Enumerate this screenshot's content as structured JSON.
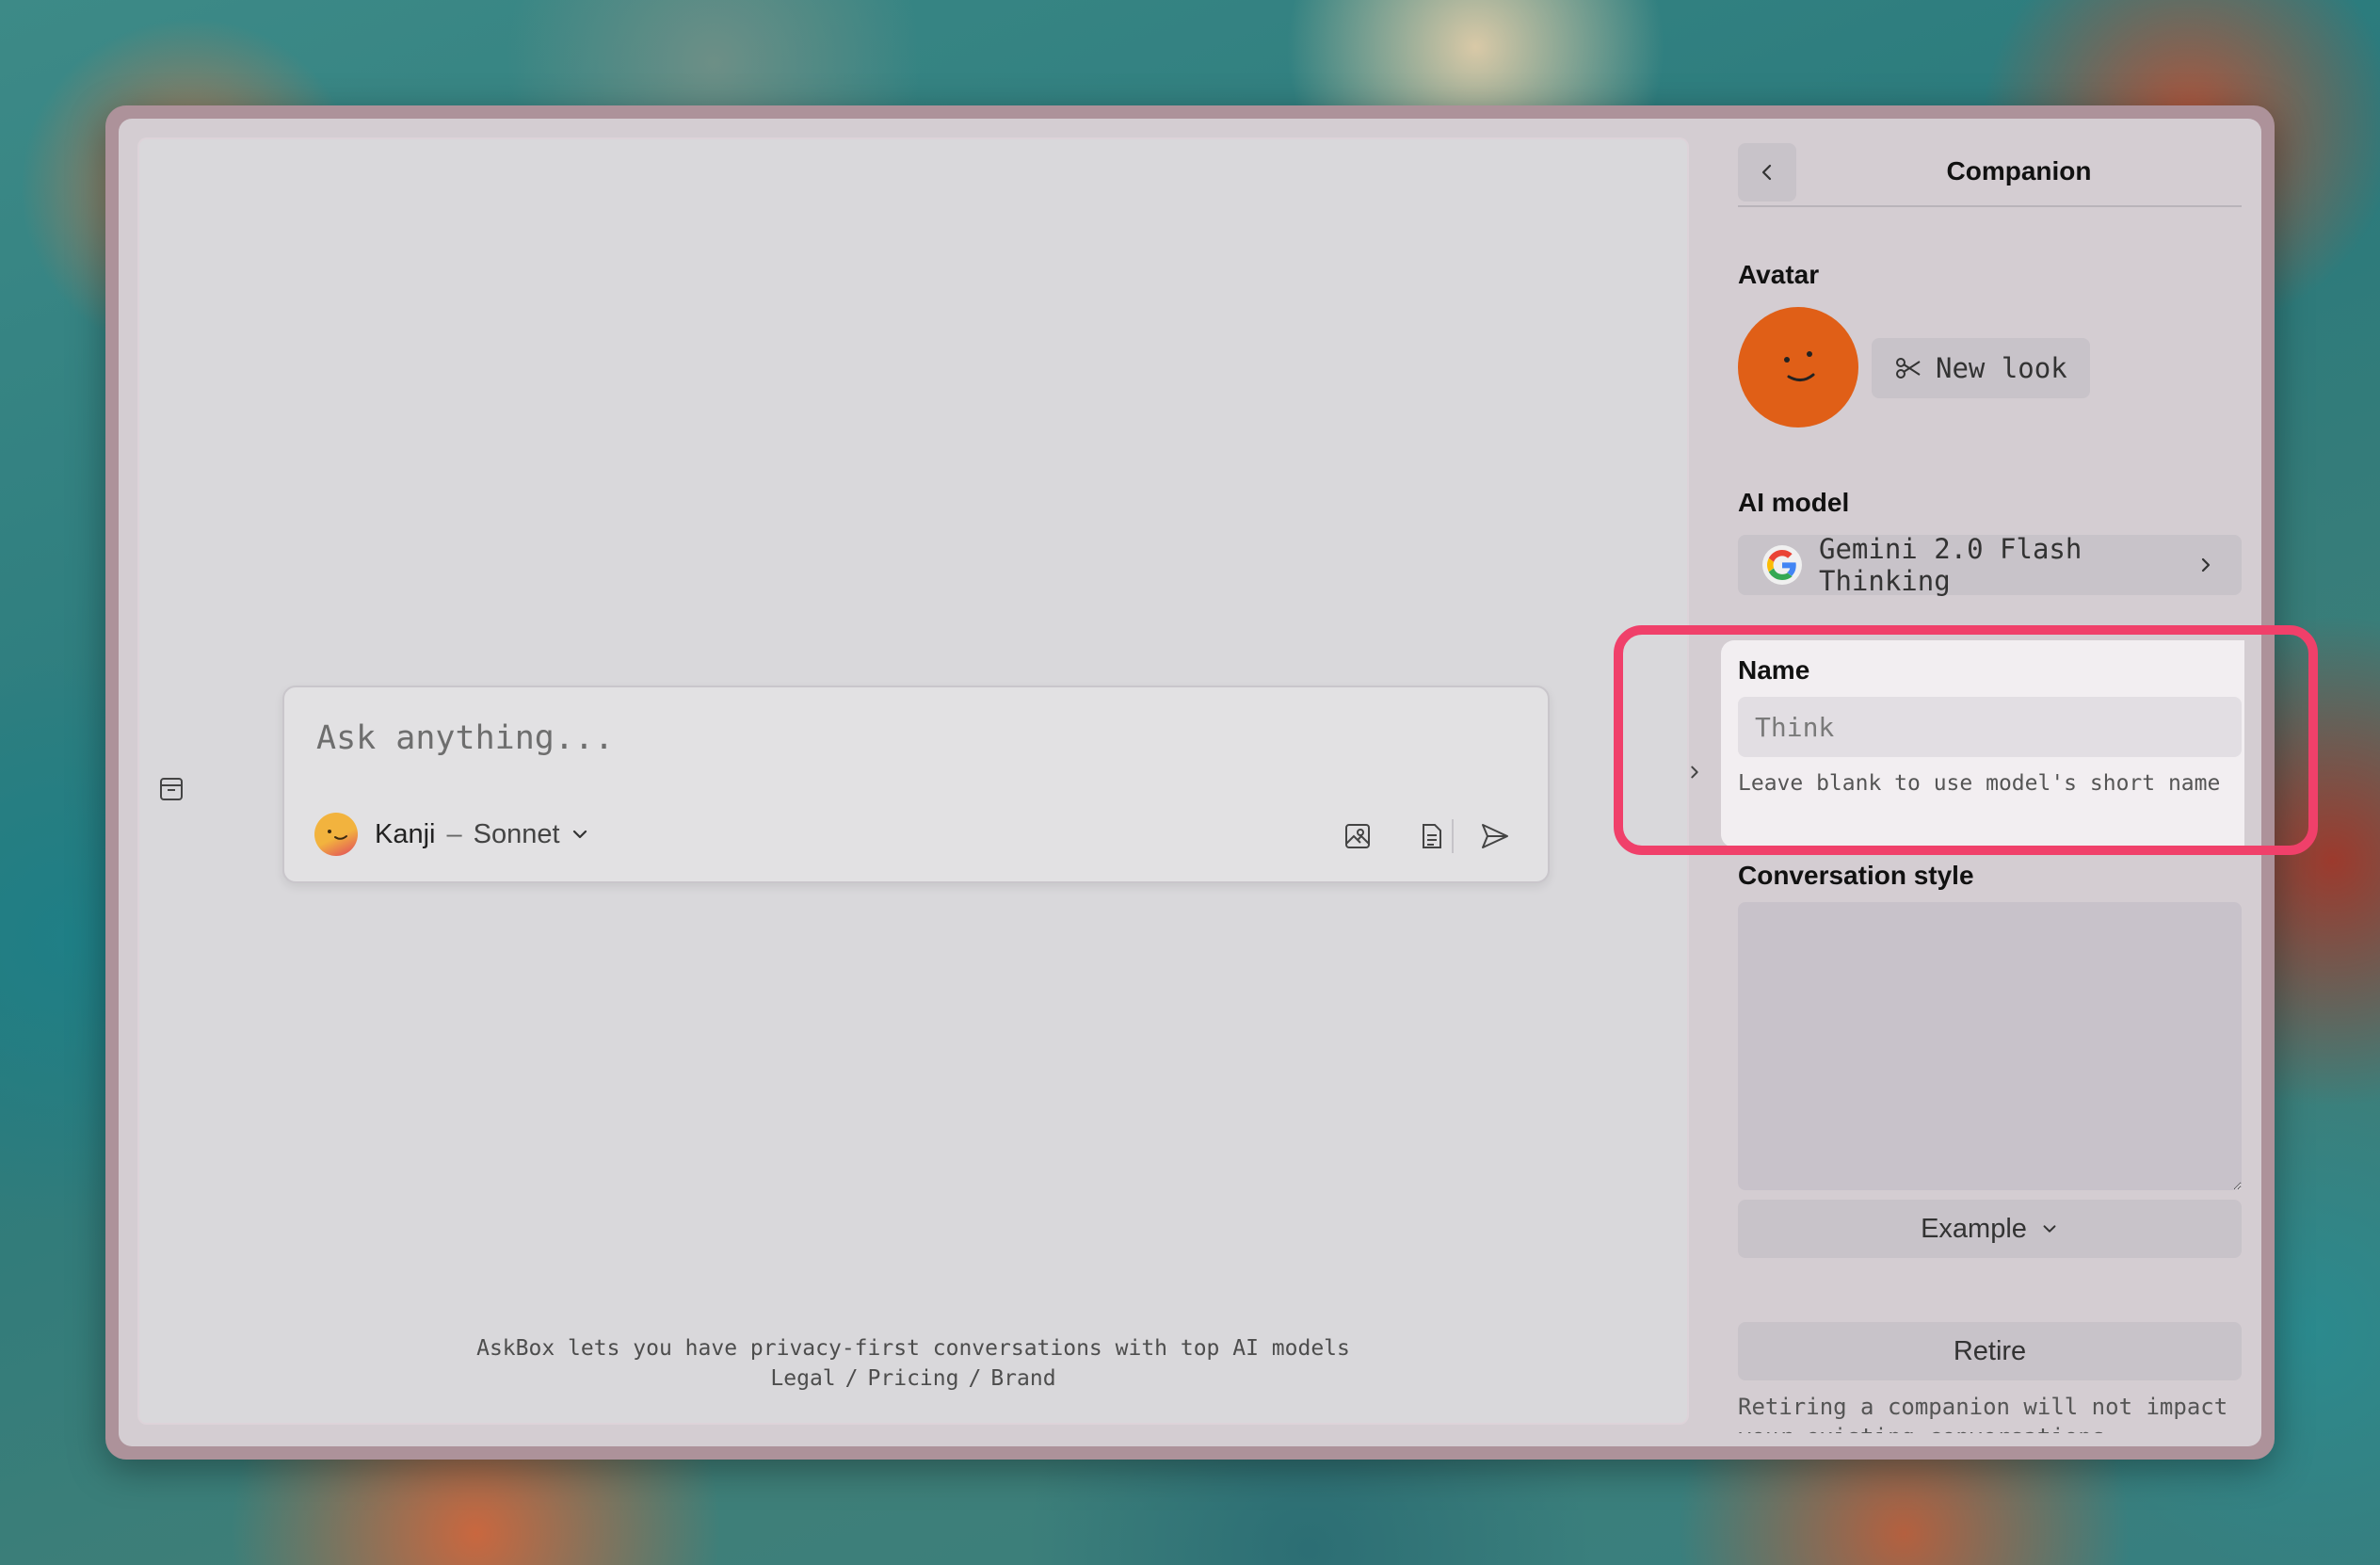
{
  "composer": {
    "placeholder": "Ask anything...",
    "companion_name": "Kanji",
    "separator": "–",
    "model_name": "Sonnet"
  },
  "footer": {
    "tagline": "AskBox lets you have privacy-first conversations with top AI models",
    "links": [
      "Legal",
      "Pricing",
      "Brand"
    ],
    "link_separator": "/"
  },
  "panel": {
    "title": "Companion",
    "avatar_label": "Avatar",
    "avatar_color": "#e05f17",
    "new_look_label": "New look",
    "ai_model_label": "AI model",
    "ai_model_value": "Gemini 2.0 Flash Thinking",
    "name_label": "Name",
    "name_placeholder": "Think",
    "name_value": "",
    "name_hint": "Leave blank to use model's short name",
    "style_label": "Conversation style",
    "style_value": "",
    "example_label": "Example",
    "retire_label": "Retire",
    "retire_note": "Retiring a companion will not impact your existing conversations"
  },
  "colors": {
    "highlight": "#f0406a",
    "panel_bg": "#d4cdd2",
    "main_bg": "#d9d8db"
  }
}
